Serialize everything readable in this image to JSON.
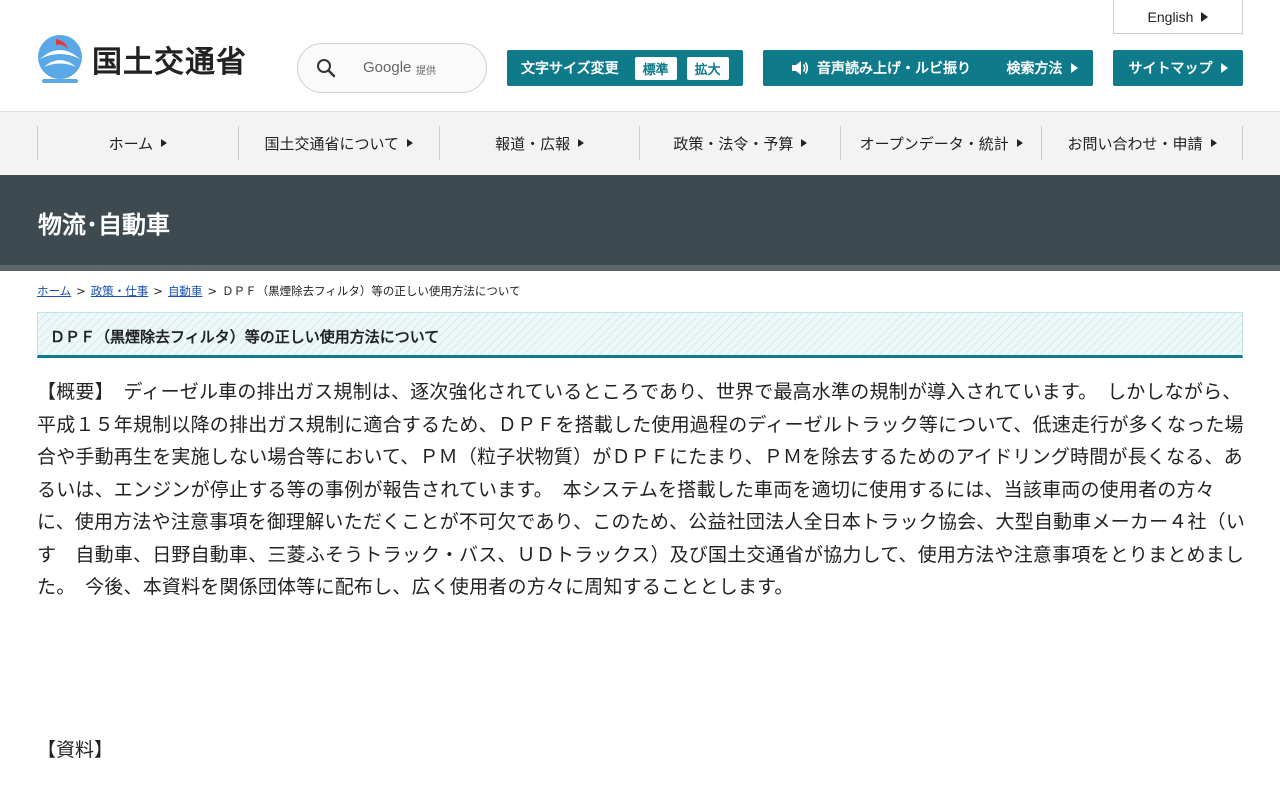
{
  "header": {
    "logo_text": "国土交通省",
    "english_label": "English",
    "search": {
      "google_label": "Google",
      "provided_label": "提供"
    },
    "fontsize": {
      "label": "文字サイズ変更",
      "standard": "標準",
      "enlarge": "拡大"
    },
    "voice_label": "音声読み上げ・ルビ振り",
    "search_method_label": "検索方法",
    "sitemap_label": "サイトマップ"
  },
  "gnav": {
    "items": [
      {
        "label": "ホーム"
      },
      {
        "label": "国土交通省について"
      },
      {
        "label": "報道・広報"
      },
      {
        "label": "政策・法令・予算"
      },
      {
        "label": "オープンデータ・統計"
      },
      {
        "label": "お問い合わせ・申請"
      }
    ]
  },
  "section": {
    "title": "物流･自動車"
  },
  "breadcrumb": {
    "items": [
      {
        "label": "ホーム"
      },
      {
        "label": "政策・仕事"
      },
      {
        "label": "自動車"
      }
    ],
    "current": "ＤＰＦ（黒煙除去フィルタ）等の正しい使用方法について"
  },
  "page": {
    "heading": "ＤＰＦ（黒煙除去フィルタ）等の正しい使用方法について",
    "body": "【概要】　ディーゼル車の排出ガス規制は、逐次強化されているところであり、世界で最高水準の規制が導入されています。　しかしながら、平成１５年規制以降の排出ガス規制に適合するため、ＤＰＦを搭載した使用過程のディーゼルトラック等について、低速走行が多くなった場合や手動再生を実施しない場合等において、ＰＭ（粒子状物質）がＤＰＦにたまり、ＰＭを除去するためのアイドリング時間が長くなる、あるいは、エンジンが停止する等の事例が報告されています。　本システムを搭載した車両を適切に使用するには、当該車両の使用者の方々に、使用方法や注意事項を御理解いただくことが不可欠であり、このため、公益社団法人全日本トラック協会、大型自動車メーカー４社（いす　自動車、日野自動車、三菱ふそうトラック・バス、ＵＤトラックス）及び国土交通省が協力して、使用方法や注意事項をとりまとめました。　今後、本資料を関係団体等に配布し、広く使用者の方々に周知することとします。",
    "materials_label": "【資料】"
  },
  "colors": {
    "accent": "#0f7b8a",
    "band": "#3d4a50",
    "link": "#1a4fb5"
  }
}
